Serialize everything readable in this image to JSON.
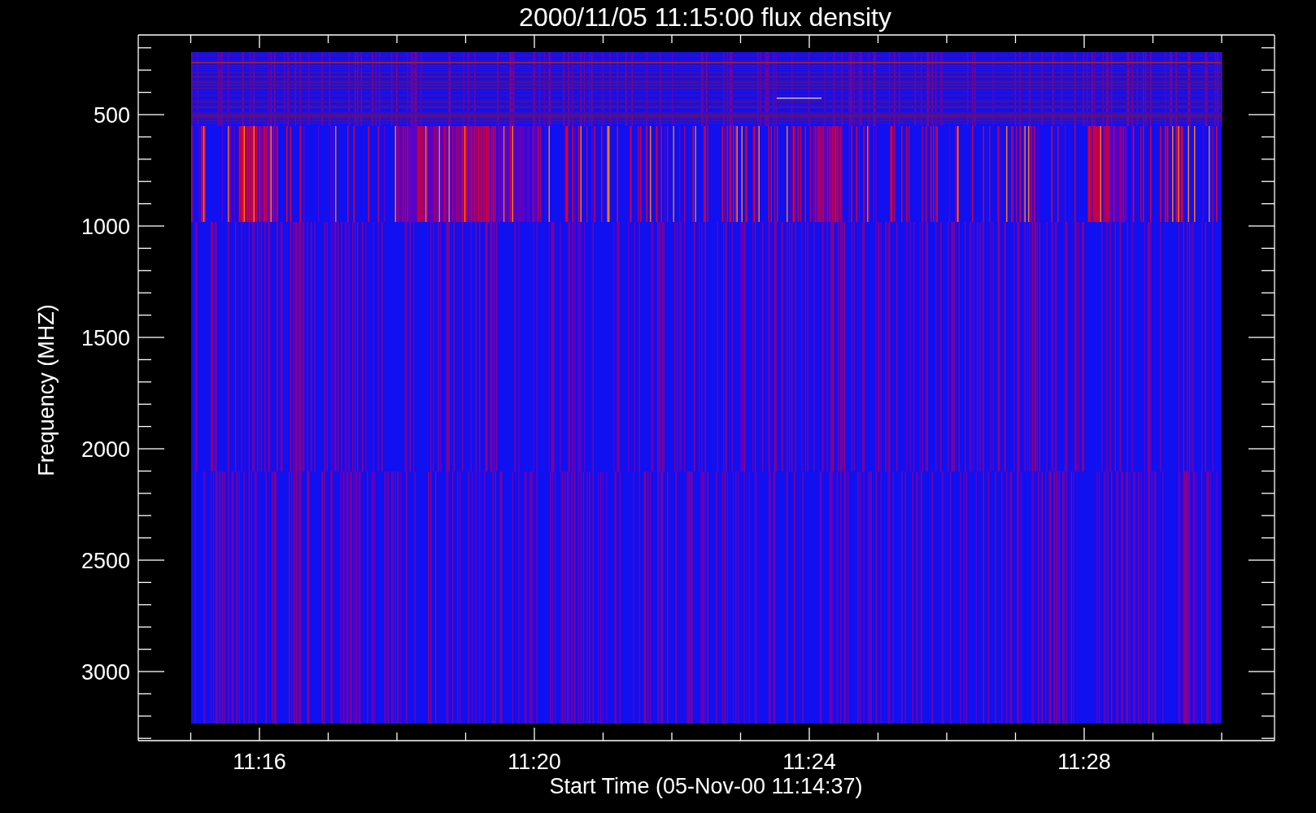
{
  "title": "2000/11/05 11:15:00 flux density",
  "y_axis": {
    "title": "Frequency (MHZ)",
    "ticks": [
      "500",
      "1000",
      "1500",
      "2000",
      "2500",
      "3000"
    ]
  },
  "x_axis": {
    "title": "Start Time (05-Nov-00 11:14:37)",
    "ticks": [
      "11:16",
      "11:20",
      "11:24",
      "11:28"
    ]
  }
}
